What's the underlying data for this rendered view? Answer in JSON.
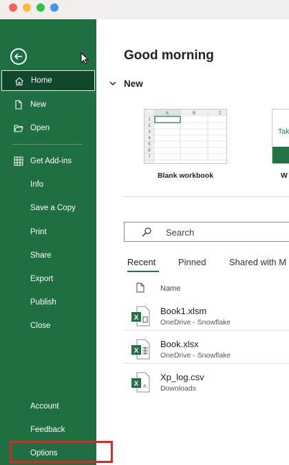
{
  "window": {
    "controls": [
      "close",
      "minimize",
      "zoom",
      "extra"
    ]
  },
  "sidebar": {
    "back_icon": "back-arrow-circle-icon",
    "items": [
      {
        "label": "Home",
        "icon": "home-icon",
        "active": true
      },
      {
        "label": "New",
        "icon": "new-document-icon"
      },
      {
        "label": "Open",
        "icon": "folder-open-icon"
      },
      {
        "label": "Get Add-ins",
        "icon": "add-ins-grid-icon"
      },
      {
        "label": "Info"
      },
      {
        "label": "Save a Copy"
      },
      {
        "label": "Print"
      },
      {
        "label": "Share"
      },
      {
        "label": "Export"
      },
      {
        "label": "Publish"
      },
      {
        "label": "Close"
      }
    ],
    "bottom_items": [
      {
        "label": "Account"
      },
      {
        "label": "Feedback"
      },
      {
        "label": "Options"
      }
    ],
    "accent_color": "#1f6f43",
    "highlight_color": "#e02424"
  },
  "main": {
    "greeting": "Good morning",
    "new_section": {
      "title": "New",
      "templates": [
        {
          "label": "Blank workbook",
          "columns": [
            "A",
            "B",
            "C"
          ],
          "rows": [
            "1",
            "2",
            "3",
            "4",
            "5",
            "6",
            "7"
          ]
        },
        {
          "label": "W",
          "preview_text": "Tak"
        }
      ]
    },
    "search": {
      "placeholder": "Search"
    },
    "tabs": [
      {
        "label": "Recent",
        "active": true
      },
      {
        "label": "Pinned"
      },
      {
        "label": "Shared with M"
      }
    ],
    "file_list": {
      "column_header": "Name",
      "files": [
        {
          "name": "Book1.xlsm",
          "location": "OneDrive - Snowflake",
          "icon": "excel-macro-file-icon"
        },
        {
          "name": "Book.xlsx",
          "location": "OneDrive - Snowflake",
          "icon": "excel-file-icon"
        },
        {
          "name": "Xp_log.csv",
          "location": "Downloads",
          "icon": "csv-file-icon"
        }
      ]
    }
  }
}
